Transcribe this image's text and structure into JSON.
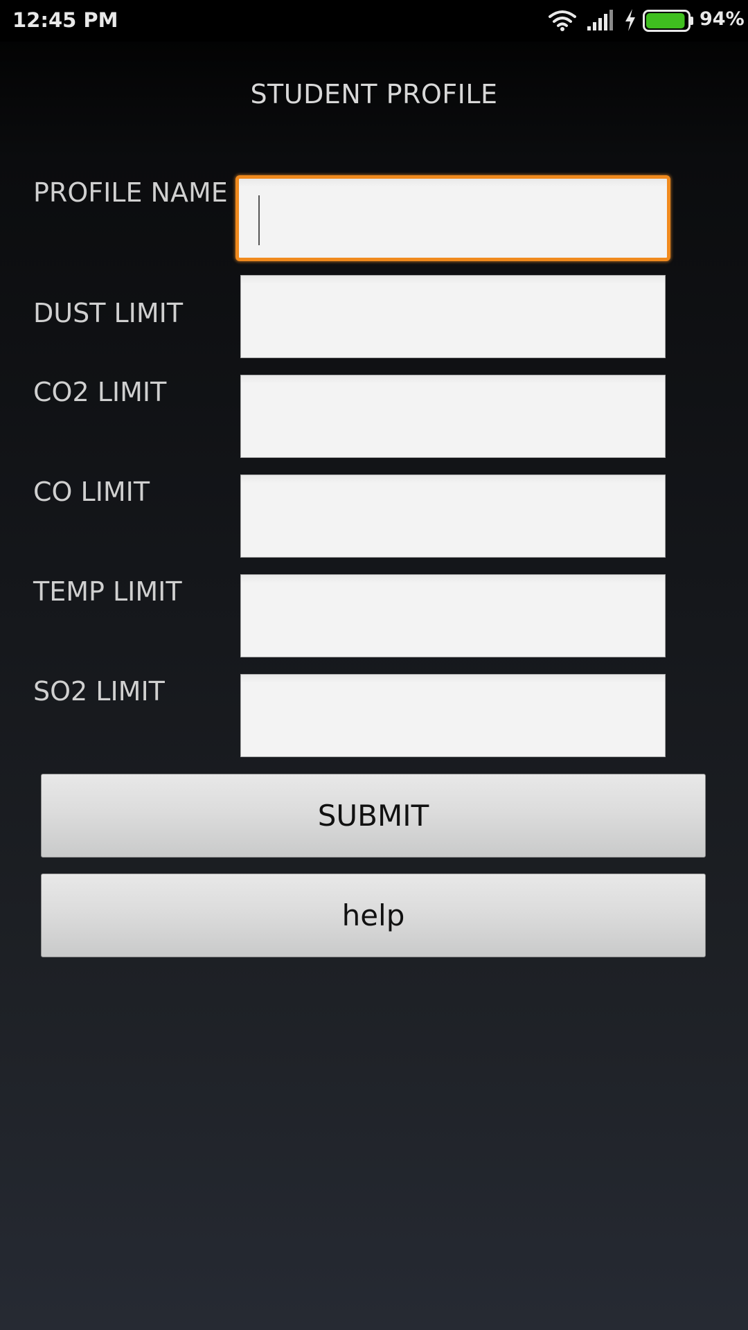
{
  "status_bar": {
    "time": "12:45 PM",
    "battery_percent": "94%",
    "battery_level": 0.94,
    "icons": [
      "wifi-icon",
      "signal-icon",
      "charging-bolt-icon",
      "battery-icon"
    ],
    "battery_color": "#3fbf1f"
  },
  "page": {
    "title": "STUDENT PROFILE"
  },
  "form": {
    "fields": [
      {
        "label": "PROFILE NAME",
        "value": ""
      },
      {
        "label": "DUST LIMIT",
        "value": ""
      },
      {
        "label": "CO2 LIMIT",
        "value": ""
      },
      {
        "label": "CO LIMIT",
        "value": ""
      },
      {
        "label": "TEMP LIMIT",
        "value": ""
      },
      {
        "label": "SO2 LIMIT",
        "value": ""
      }
    ],
    "focus_color": "#f08a1e"
  },
  "buttons": {
    "submit": "SUBMIT",
    "help": "help"
  }
}
